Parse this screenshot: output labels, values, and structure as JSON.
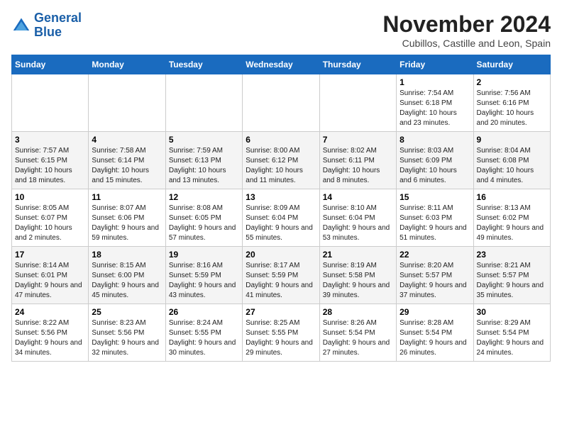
{
  "header": {
    "logo_line1": "General",
    "logo_line2": "Blue",
    "month": "November 2024",
    "location": "Cubillos, Castille and Leon, Spain"
  },
  "days_of_week": [
    "Sunday",
    "Monday",
    "Tuesday",
    "Wednesday",
    "Thursday",
    "Friday",
    "Saturday"
  ],
  "weeks": [
    [
      {
        "num": "",
        "info": ""
      },
      {
        "num": "",
        "info": ""
      },
      {
        "num": "",
        "info": ""
      },
      {
        "num": "",
        "info": ""
      },
      {
        "num": "",
        "info": ""
      },
      {
        "num": "1",
        "info": "Sunrise: 7:54 AM\nSunset: 6:18 PM\nDaylight: 10 hours and 23 minutes."
      },
      {
        "num": "2",
        "info": "Sunrise: 7:56 AM\nSunset: 6:16 PM\nDaylight: 10 hours and 20 minutes."
      }
    ],
    [
      {
        "num": "3",
        "info": "Sunrise: 7:57 AM\nSunset: 6:15 PM\nDaylight: 10 hours and 18 minutes."
      },
      {
        "num": "4",
        "info": "Sunrise: 7:58 AM\nSunset: 6:14 PM\nDaylight: 10 hours and 15 minutes."
      },
      {
        "num": "5",
        "info": "Sunrise: 7:59 AM\nSunset: 6:13 PM\nDaylight: 10 hours and 13 minutes."
      },
      {
        "num": "6",
        "info": "Sunrise: 8:00 AM\nSunset: 6:12 PM\nDaylight: 10 hours and 11 minutes."
      },
      {
        "num": "7",
        "info": "Sunrise: 8:02 AM\nSunset: 6:11 PM\nDaylight: 10 hours and 8 minutes."
      },
      {
        "num": "8",
        "info": "Sunrise: 8:03 AM\nSunset: 6:09 PM\nDaylight: 10 hours and 6 minutes."
      },
      {
        "num": "9",
        "info": "Sunrise: 8:04 AM\nSunset: 6:08 PM\nDaylight: 10 hours and 4 minutes."
      }
    ],
    [
      {
        "num": "10",
        "info": "Sunrise: 8:05 AM\nSunset: 6:07 PM\nDaylight: 10 hours and 2 minutes."
      },
      {
        "num": "11",
        "info": "Sunrise: 8:07 AM\nSunset: 6:06 PM\nDaylight: 9 hours and 59 minutes."
      },
      {
        "num": "12",
        "info": "Sunrise: 8:08 AM\nSunset: 6:05 PM\nDaylight: 9 hours and 57 minutes."
      },
      {
        "num": "13",
        "info": "Sunrise: 8:09 AM\nSunset: 6:04 PM\nDaylight: 9 hours and 55 minutes."
      },
      {
        "num": "14",
        "info": "Sunrise: 8:10 AM\nSunset: 6:04 PM\nDaylight: 9 hours and 53 minutes."
      },
      {
        "num": "15",
        "info": "Sunrise: 8:11 AM\nSunset: 6:03 PM\nDaylight: 9 hours and 51 minutes."
      },
      {
        "num": "16",
        "info": "Sunrise: 8:13 AM\nSunset: 6:02 PM\nDaylight: 9 hours and 49 minutes."
      }
    ],
    [
      {
        "num": "17",
        "info": "Sunrise: 8:14 AM\nSunset: 6:01 PM\nDaylight: 9 hours and 47 minutes."
      },
      {
        "num": "18",
        "info": "Sunrise: 8:15 AM\nSunset: 6:00 PM\nDaylight: 9 hours and 45 minutes."
      },
      {
        "num": "19",
        "info": "Sunrise: 8:16 AM\nSunset: 5:59 PM\nDaylight: 9 hours and 43 minutes."
      },
      {
        "num": "20",
        "info": "Sunrise: 8:17 AM\nSunset: 5:59 PM\nDaylight: 9 hours and 41 minutes."
      },
      {
        "num": "21",
        "info": "Sunrise: 8:19 AM\nSunset: 5:58 PM\nDaylight: 9 hours and 39 minutes."
      },
      {
        "num": "22",
        "info": "Sunrise: 8:20 AM\nSunset: 5:57 PM\nDaylight: 9 hours and 37 minutes."
      },
      {
        "num": "23",
        "info": "Sunrise: 8:21 AM\nSunset: 5:57 PM\nDaylight: 9 hours and 35 minutes."
      }
    ],
    [
      {
        "num": "24",
        "info": "Sunrise: 8:22 AM\nSunset: 5:56 PM\nDaylight: 9 hours and 34 minutes."
      },
      {
        "num": "25",
        "info": "Sunrise: 8:23 AM\nSunset: 5:56 PM\nDaylight: 9 hours and 32 minutes."
      },
      {
        "num": "26",
        "info": "Sunrise: 8:24 AM\nSunset: 5:55 PM\nDaylight: 9 hours and 30 minutes."
      },
      {
        "num": "27",
        "info": "Sunrise: 8:25 AM\nSunset: 5:55 PM\nDaylight: 9 hours and 29 minutes."
      },
      {
        "num": "28",
        "info": "Sunrise: 8:26 AM\nSunset: 5:54 PM\nDaylight: 9 hours and 27 minutes."
      },
      {
        "num": "29",
        "info": "Sunrise: 8:28 AM\nSunset: 5:54 PM\nDaylight: 9 hours and 26 minutes."
      },
      {
        "num": "30",
        "info": "Sunrise: 8:29 AM\nSunset: 5:54 PM\nDaylight: 9 hours and 24 minutes."
      }
    ]
  ]
}
